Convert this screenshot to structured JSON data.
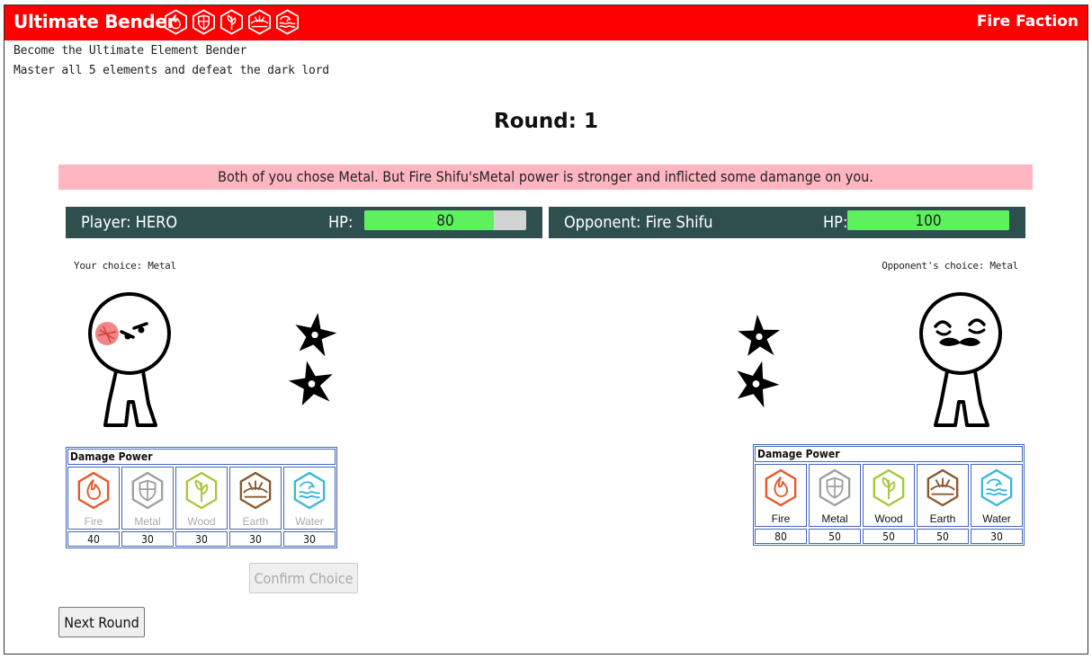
{
  "header": {
    "title": "Ultimate Bender",
    "faction": "Fire Faction",
    "icons": [
      "fire-icon",
      "metal-icon",
      "wood-icon",
      "earth-icon",
      "water-icon"
    ]
  },
  "intro": {
    "line1": "Become the Ultimate Element Bender",
    "line2": "Master all 5 elements and defeat the dark lord"
  },
  "round": {
    "label": "Round: 1"
  },
  "message": "Both of you chose Metal. But Fire Shifu'sMetal power is stronger and inflicted some damange on you.",
  "player": {
    "label": "Player: HERO",
    "hp_label": "HP:",
    "hp": "80",
    "hp_fraction": 0.8,
    "choice": "Your choice: Metal",
    "damage_title": "Damage Power",
    "damage": [
      {
        "element": "Fire",
        "value": "40"
      },
      {
        "element": "Metal",
        "value": "30"
      },
      {
        "element": "Wood",
        "value": "30"
      },
      {
        "element": "Earth",
        "value": "30"
      },
      {
        "element": "Water",
        "value": "30"
      }
    ]
  },
  "opponent": {
    "label": "Opponent: Fire Shifu",
    "hp_label": "HP:",
    "hp": "100",
    "hp_fraction": 1.0,
    "choice": "Opponent's choice: Metal",
    "damage_title": "Damage Power",
    "damage": [
      {
        "element": "Fire",
        "value": "80"
      },
      {
        "element": "Metal",
        "value": "50"
      },
      {
        "element": "Wood",
        "value": "50"
      },
      {
        "element": "Earth",
        "value": "50"
      },
      {
        "element": "Water",
        "value": "30"
      }
    ]
  },
  "buttons": {
    "confirm": "Confirm Choice",
    "next": "Next Round"
  },
  "colors": {
    "header": "#ff0000",
    "status_bar": "#2f4f4f",
    "hp_fill": "#5ef05e",
    "message_bg": "#ffb6c1",
    "fire": "#e8582a",
    "metal": "#a0a0a0",
    "wood": "#a8c83c",
    "earth": "#8a5a30",
    "water": "#3cb8d8"
  }
}
